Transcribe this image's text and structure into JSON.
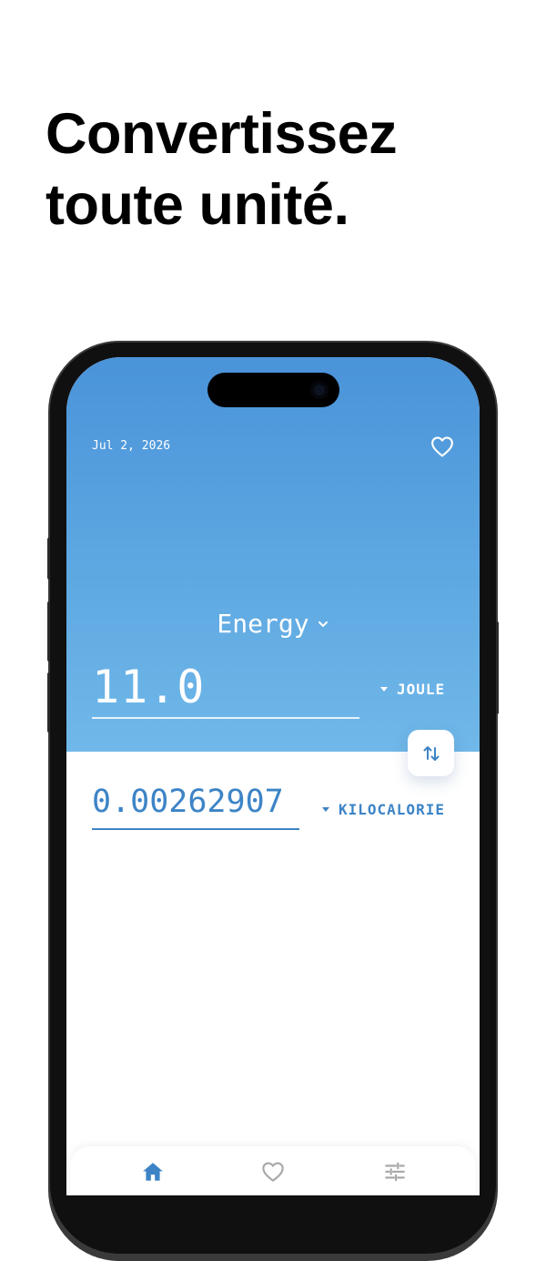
{
  "headline": {
    "line1": "Convertissez",
    "line2": "toute unité."
  },
  "app": {
    "date": "Jul 2, 2026",
    "category": "Energy",
    "input": {
      "value": "11.0",
      "unit": "JOULE"
    },
    "output": {
      "value": "0.00262907",
      "unit": "KILOCALORIE"
    },
    "icons": {
      "favorite": "heart-outline-icon",
      "category_dropdown": "chevron-down-icon",
      "unit_dropdown": "caret-down-icon",
      "swap": "swap-vertical-icon"
    },
    "tabs": [
      {
        "name": "home",
        "icon": "home-icon",
        "active": true
      },
      {
        "name": "favorites",
        "icon": "heart-outline-icon",
        "active": false
      },
      {
        "name": "settings",
        "icon": "sliders-icon",
        "active": false
      }
    ]
  },
  "colors": {
    "accent": "#3d84c6",
    "gradient_top": "#4a93d9",
    "gradient_bottom": "#70b8e9",
    "inactive_icon": "#a9a9a9"
  }
}
